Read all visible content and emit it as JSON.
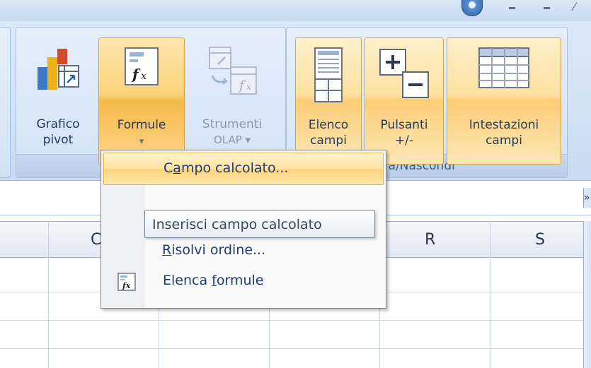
{
  "ribbon": {
    "groups": {
      "show_hide_label": "tra/Nascondi"
    },
    "buttons": {
      "grafico_pivot": {
        "line1": "Grafico",
        "line2": "pivot"
      },
      "formule": {
        "line1": "Formule",
        "line2": "▾"
      },
      "strumenti_olap": {
        "line1": "Strumenti",
        "line2": "OLAP ▾"
      },
      "elenco_campi": {
        "line1": "Elenco",
        "line2": "campi"
      },
      "pulsanti": {
        "line1": "Pulsanti",
        "line2": "+/-"
      },
      "intestazioni_campi": {
        "line1": "Intestazioni",
        "line2": "campi"
      }
    }
  },
  "menu": {
    "items": [
      {
        "pre": "C",
        "accel": "a",
        "post": "mpo calcolato..."
      },
      {
        "pre": "",
        "accel": "R",
        "post": "isolvi ordine..."
      },
      {
        "pre": "Elenca ",
        "accel": "f",
        "post": "ormule"
      }
    ],
    "tooltip": "Inserisci campo calcolato"
  },
  "sheet": {
    "columns": [
      "C",
      "R",
      "S"
    ]
  },
  "colors": {
    "ribbon_bg": "#d2e1f4",
    "highlight": "#fbd27a",
    "menu_text": "#1e3a78"
  },
  "icons": [
    "help-icon",
    "pivot-chart-icon",
    "formulas-icon",
    "olap-tools-icon",
    "field-list-icon",
    "plus-minus-icon",
    "field-headers-icon",
    "list-formulas-icon"
  ]
}
